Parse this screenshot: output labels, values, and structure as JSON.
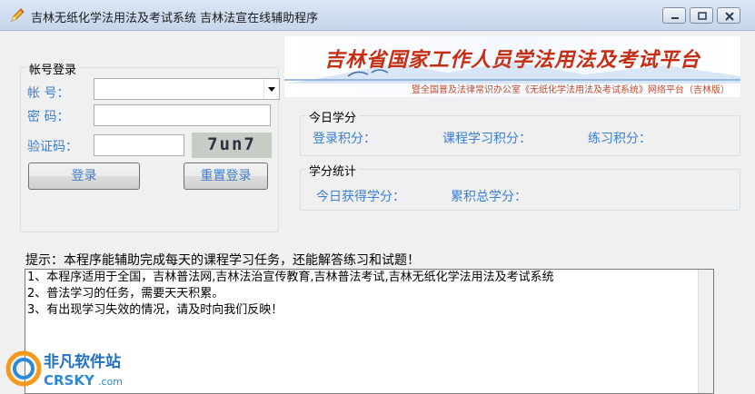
{
  "window": {
    "title": "吉林无纸化学法用法及考试系统 吉林法宣在线辅助程序"
  },
  "login": {
    "group_label": "帐号登录",
    "account_label": "帐  号：",
    "password_label": "密  码：",
    "captcha_label": "验证码：",
    "account_value": "",
    "password_value": "",
    "captcha_input_value": "",
    "captcha_image_text": "7un7",
    "login_button": "登录",
    "reset_button": "重置登录"
  },
  "banner": {
    "title": "吉林省国家工作人员学法用法及考试平台",
    "subtitle": "暨全国普及法律常识办公室《无纸化学法用法及考试系统》网络平台（吉林版）"
  },
  "today": {
    "group_label": "今日学分",
    "login_score_label": "登录积分：",
    "course_score_label": "课程学习积分：",
    "practice_score_label": "练习积分："
  },
  "stats": {
    "group_label": "学分统计",
    "today_gained_label": "今日获得学分：",
    "total_label": "累积总学分："
  },
  "hint": {
    "text": "提示：本程序能辅助完成每天的课程学习任务，还能解答练习和试题！"
  },
  "memo": {
    "lines": [
      "1、本程序适用于全国，吉林普法网,吉林法治宣传教育,吉林普法考试,吉林无纸化学法用法及考试系统",
      "2、普法学习的任务，需要天天积累。",
      "3、有出现学习失效的情况，请及时向我们反映！"
    ]
  },
  "watermark": {
    "cn": "非凡软件站",
    "en": "CRSKY",
    "suffix": ".com"
  },
  "colors": {
    "label_blue": "#3a7fd5",
    "banner_red": "#c62e14",
    "form_bg": "#f0f0f0"
  }
}
